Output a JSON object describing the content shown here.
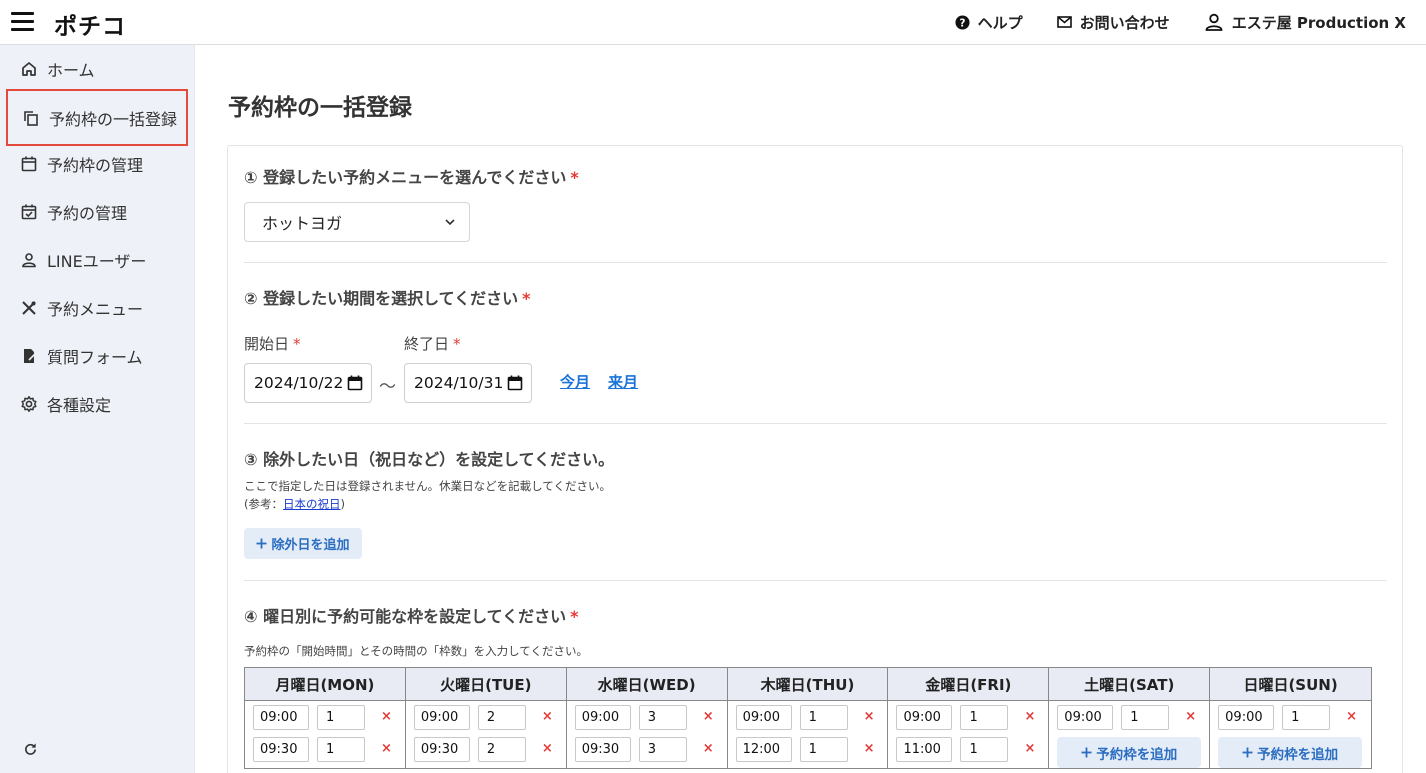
{
  "header": {
    "logo": "ポチコ",
    "help": "ヘルプ",
    "contact": "お問い合わせ",
    "account": "エステ屋 Production X"
  },
  "sidebar": {
    "items": [
      {
        "label": "ホーム",
        "icon": "home-icon"
      },
      {
        "label": "予約枠の一括登録",
        "icon": "copy-icon"
      },
      {
        "label": "予約枠の管理",
        "icon": "calendar-icon"
      },
      {
        "label": "予約の管理",
        "icon": "calendar-check-icon"
      },
      {
        "label": "LINEユーザー",
        "icon": "person-icon"
      },
      {
        "label": "予約メニュー",
        "icon": "utensils-icon"
      },
      {
        "label": "質問フォーム",
        "icon": "form-icon"
      },
      {
        "label": "各種設定",
        "icon": "gear-icon"
      }
    ],
    "active_index": 1
  },
  "page": {
    "title": "予約枠の一括登録"
  },
  "section1": {
    "title": "① 登録したい予約メニューを選んでください",
    "required_mark": "*",
    "menu_value": "ホットヨガ"
  },
  "section2": {
    "title": "② 登録したい期間を選択してください",
    "required_mark": "*",
    "start_label": "開始日",
    "end_label": "終了日",
    "start_value": "2024/10/22",
    "end_value": "2024/10/31",
    "separator": "〜",
    "this_month": "今月",
    "next_month": "来月"
  },
  "section3": {
    "title": "③ 除外したい日（祝日など）を設定してください。",
    "note1": "ここで指定した日は登録されません。休業日などを記載してください。",
    "note2_prefix": "(参考：",
    "note2_link": "日本の祝日",
    "note2_suffix": ")",
    "add_button": "除外日を追加"
  },
  "section4": {
    "title": "④ 曜日別に予約可能な枠を設定してください",
    "required_mark": "*",
    "note": "予約枠の「開始時間」とその時間の「枠数」を入力してください。",
    "delete_mark": "×",
    "add_slot_label": "予約枠を追加",
    "days": [
      {
        "name": "月曜日(MON)",
        "slots": [
          {
            "time": "09:00",
            "count": "1"
          },
          {
            "time": "09:30",
            "count": "1"
          }
        ]
      },
      {
        "name": "火曜日(TUE)",
        "slots": [
          {
            "time": "09:00",
            "count": "2"
          },
          {
            "time": "09:30",
            "count": "2"
          }
        ]
      },
      {
        "name": "水曜日(WED)",
        "slots": [
          {
            "time": "09:00",
            "count": "3"
          },
          {
            "time": "09:30",
            "count": "3"
          }
        ]
      },
      {
        "name": "木曜日(THU)",
        "slots": [
          {
            "time": "09:00",
            "count": "1"
          },
          {
            "time": "12:00",
            "count": "1"
          }
        ]
      },
      {
        "name": "金曜日(FRI)",
        "slots": [
          {
            "time": "09:00",
            "count": "1"
          },
          {
            "time": "11:00",
            "count": "1"
          }
        ]
      },
      {
        "name": "土曜日(SAT)",
        "slots": [
          {
            "time": "09:00",
            "count": "1"
          }
        ]
      },
      {
        "name": "日曜日(SUN)",
        "slots": [
          {
            "time": "09:00",
            "count": "1"
          }
        ]
      }
    ]
  },
  "colors": {
    "accent": "#1a73d9",
    "active_border": "#e34a3d",
    "required": "#e53935",
    "sidebar_bg": "#eef1f8"
  }
}
